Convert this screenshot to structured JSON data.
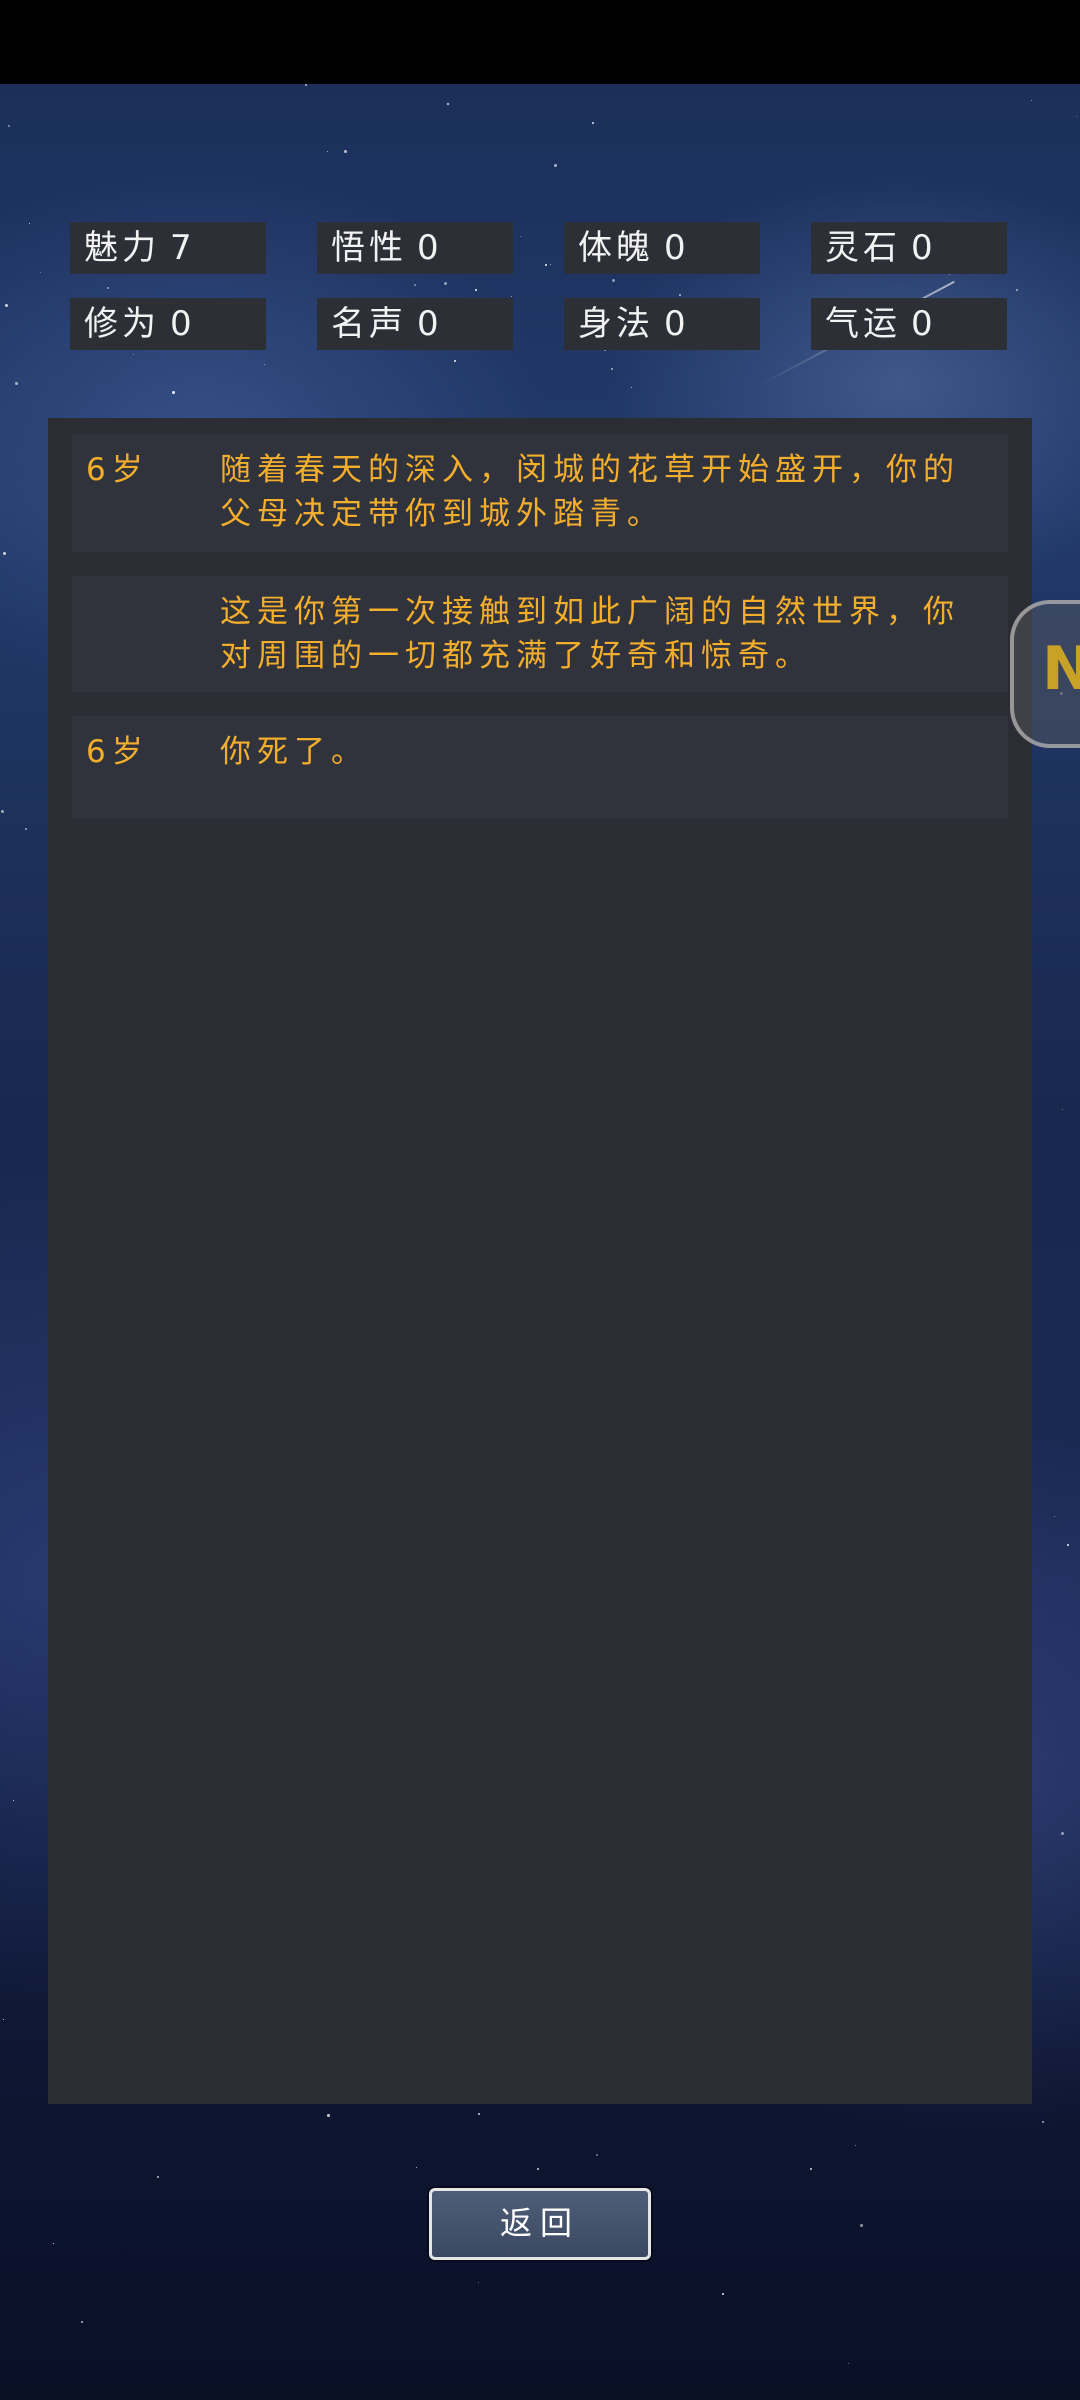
{
  "stats": [
    {
      "label": "魅力",
      "value": "7"
    },
    {
      "label": "悟性",
      "value": "0"
    },
    {
      "label": "体魄",
      "value": "0"
    },
    {
      "label": "灵石",
      "value": "0"
    },
    {
      "label": "修为",
      "value": "0"
    },
    {
      "label": "名声",
      "value": "0"
    },
    {
      "label": "身法",
      "value": "0"
    },
    {
      "label": "气运",
      "value": "0"
    }
  ],
  "log": [
    {
      "age": "6岁",
      "text": "随着春天的深入，闵城的花草开始盛开，你的父母决定带你到城外踏青。"
    },
    {
      "age": "",
      "text": "这是你第一次接触到如此广阔的自然世界，你对周围的一切都充满了好奇和惊奇。"
    },
    {
      "age": "6岁",
      "text": "你死了。"
    }
  ],
  "side_button": {
    "glyph": "N"
  },
  "back_button": {
    "label": "返回"
  },
  "colors": {
    "log_text": "#f3ae2c",
    "panel": "#2b2c34",
    "stat_bg": "#2d2f37"
  }
}
